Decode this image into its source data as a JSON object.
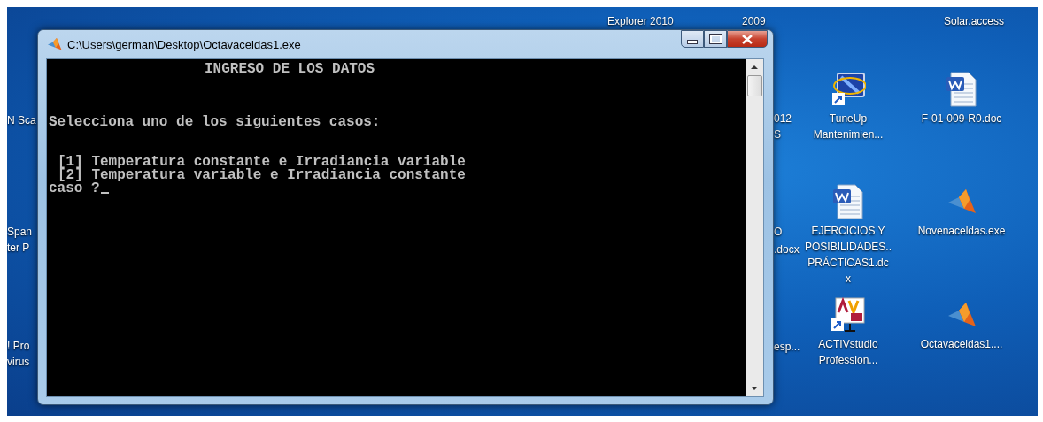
{
  "desktop": {
    "top_labels": [
      "Explorer 2010",
      "2009",
      "Solar.access"
    ],
    "fragments": [
      "N Sca",
      "Span",
      "ter P",
      "! Pro",
      "virus",
      "012",
      "S",
      "O",
      ".docx",
      "esp..."
    ],
    "icons": [
      {
        "kind": "tuneup",
        "lines": [
          "TuneUp",
          "Mantenimien..."
        ]
      },
      {
        "kind": "word",
        "lines": [
          "F-01-009-R0.doc"
        ]
      },
      {
        "kind": "word",
        "lines": [
          "EJERCICIOS Y",
          "POSIBILIDADES..",
          "PRÁCTICAS1.dc",
          "x"
        ]
      },
      {
        "kind": "matlab",
        "lines": [
          "Novenaceldas.exe"
        ]
      },
      {
        "kind": "activ",
        "lines": [
          "ACTIVstudio",
          "Profession..."
        ]
      },
      {
        "kind": "matlab",
        "lines": [
          "Octavaceldas1...."
        ]
      }
    ]
  },
  "window": {
    "title": "C:\\Users\\german\\Desktop\\Octavaceldas1.exe",
    "console": [
      {
        "kind": "heading",
        "text": "INGRESO DE LOS DATOS"
      },
      {
        "kind": "text",
        "text": "Selecciona uno de los siguientes casos:"
      },
      {
        "kind": "option",
        "text": "[1] Temperatura constante e Irradiancia variable"
      },
      {
        "kind": "option2",
        "text": "[2] Temperatura variable e Irradiancia constante"
      },
      {
        "kind": "prompt",
        "text": "caso ?"
      }
    ]
  }
}
